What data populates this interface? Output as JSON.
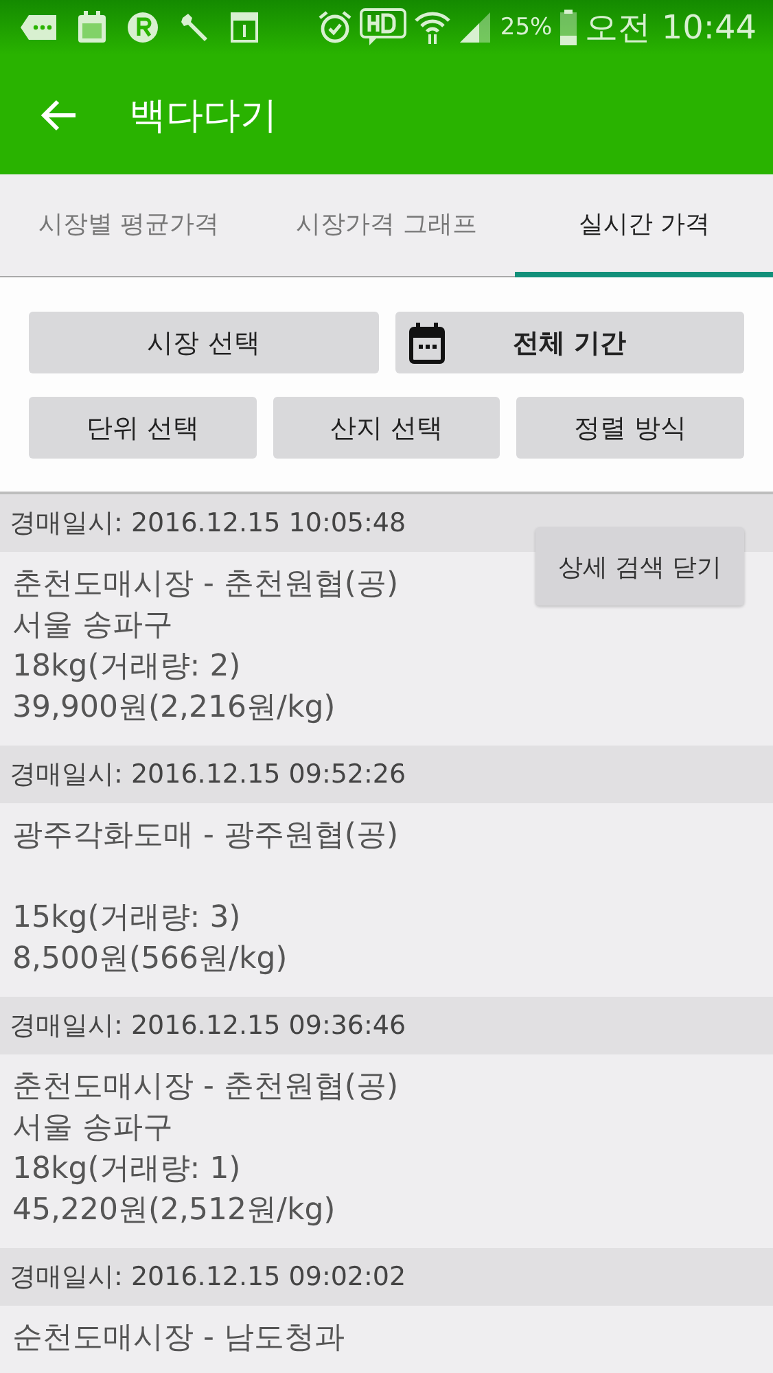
{
  "status_bar": {
    "battery": "25%",
    "time": "오전 10:44"
  },
  "app_bar": {
    "title": "백다다기"
  },
  "tabs": [
    {
      "label": "시장별 평균가격",
      "selected": false
    },
    {
      "label": "시장가격 그래프",
      "selected": false
    },
    {
      "label": "실시간 가격",
      "selected": true
    }
  ],
  "filters": {
    "row_1": [
      {
        "label": "시장 선택",
        "kind": "plain"
      },
      {
        "label": "전체 기간",
        "kind": "calendar"
      }
    ],
    "row_2": [
      {
        "label": "단위 선택",
        "kind": "plain"
      },
      {
        "label": "산지 선택",
        "kind": "plain"
      },
      {
        "label": "정렬 방식",
        "kind": "plain"
      }
    ]
  },
  "floating_button": {
    "label": "상세 검색 닫기"
  },
  "auctions": [
    {
      "time": "경매일시: 2016.12.15 10:05:48",
      "market": "춘천도매시장 - 춘천원협(공)",
      "origin": "서울 송파구",
      "quantity": "18kg(거래량: 2)",
      "price": "39,900원(2,216원/kg)"
    },
    {
      "time": "경매일시: 2016.12.15 09:52:26",
      "market": "광주각화도매 - 광주원협(공)",
      "quantity": "15kg(거래량: 3)",
      "price": "8,500원(566원/kg)"
    },
    {
      "time": "경매일시: 2016.12.15 09:36:46",
      "market": "춘천도매시장 - 춘천원협(공)",
      "origin": "서울 송파구",
      "quantity": "18kg(거래량: 1)",
      "price": "45,220원(2,512원/kg)"
    },
    {
      "time": "경매일시: 2016.12.15 09:02:02",
      "market": "순천도매시장 - 남도청과"
    }
  ]
}
